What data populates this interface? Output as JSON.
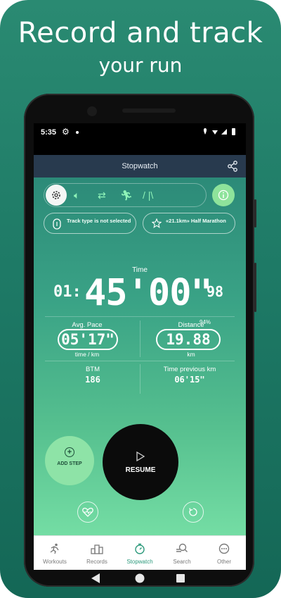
{
  "promo": {
    "headline": "Record and track",
    "subheadline": "your run"
  },
  "status_bar": {
    "time": "5:35"
  },
  "app_bar": {
    "title": "Stopwatch"
  },
  "track_info": {
    "track_type": "Track type is not selected",
    "goal": "«21.1km» Half Marathon"
  },
  "timer": {
    "label": "Time",
    "hours": "01:",
    "main": "45'00\"",
    "hundredths": "98"
  },
  "stats": {
    "avg_pace_label": "Avg. Pace",
    "avg_pace_value": "05'17\"",
    "avg_pace_unit": "time / km",
    "distance_label": "Distance",
    "distance_percent": "94%",
    "distance_value": "19.88",
    "distance_unit": "km",
    "bpm_label": "BTM",
    "bpm_value": "186",
    "prev_km_label": "Time previous km",
    "prev_km_value": "06'15\""
  },
  "controls": {
    "add_step": "ADD STEP",
    "resume": "RESUME"
  },
  "bottom_nav": [
    {
      "label": "Workouts",
      "icon": "workouts-icon"
    },
    {
      "label": "Records",
      "icon": "records-icon"
    },
    {
      "label": "Stopwatch",
      "icon": "stopwatch-icon",
      "active": true
    },
    {
      "label": "Search",
      "icon": "search-icon"
    },
    {
      "label": "Other",
      "icon": "more-icon"
    }
  ],
  "colors": {
    "background": "#1e7a66",
    "app_bar": "#283a4e",
    "accent_green": "#8ee3a7",
    "active_nav": "#2d9a7c"
  }
}
